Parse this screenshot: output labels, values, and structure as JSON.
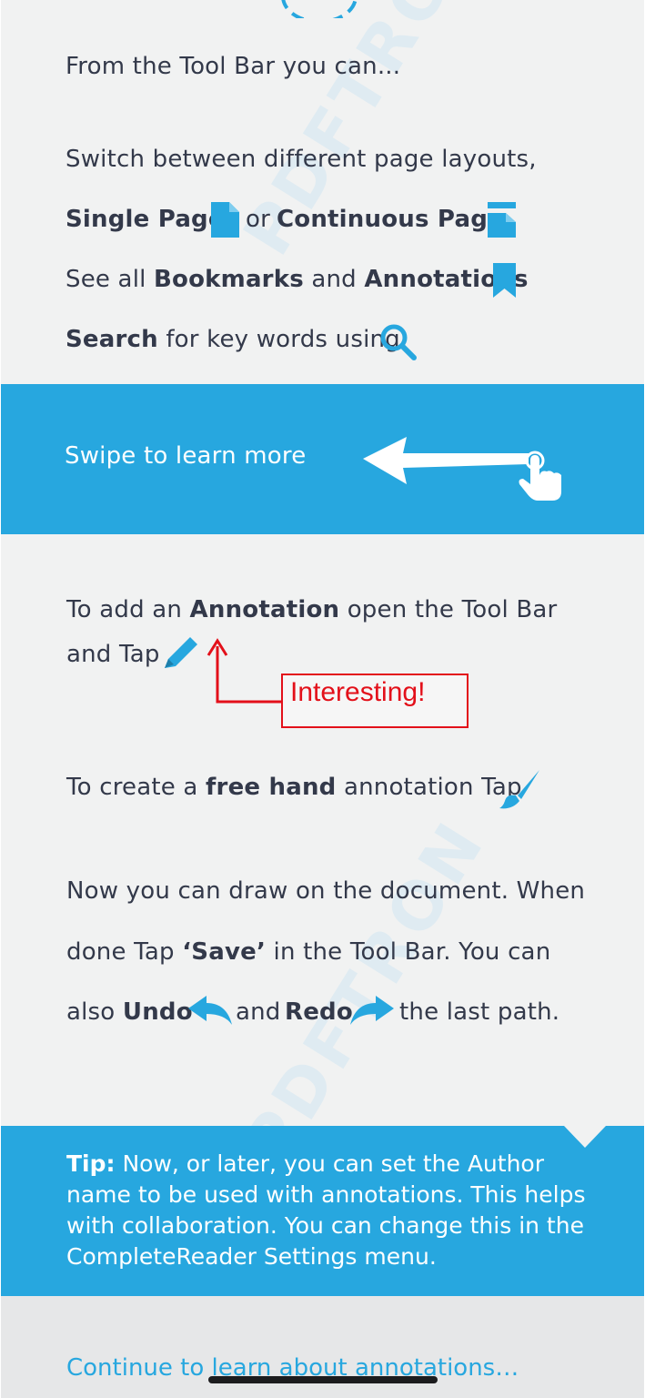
{
  "watermark": "PDFTRON",
  "toolbar_section": {
    "intro": "From the Tool Bar you can...",
    "switch_line": "Switch between different page layouts,",
    "single_page": "Single Page",
    "or": "or",
    "continuous_page": "Continuous Page",
    "see_all": "See all",
    "bookmarks": "Bookmarks",
    "and": "and",
    "annotations": "Annotations",
    "search": "Search",
    "search_rest": "for key words using"
  },
  "swipe_banner": {
    "label": "Swipe to learn more"
  },
  "annotation_section": {
    "l1_pre": "To add an",
    "l1_bold": "Annotation",
    "l1_post": "open the Tool Bar",
    "l2": "and Tap",
    "note": "Interesting!",
    "fh_pre": "To create a",
    "fh_bold": "free hand",
    "fh_post": "annotation Tap",
    "draw_l1": "Now you can draw on the document. When",
    "draw_l2_pre": "done Tap",
    "draw_l2_bold": "‘Save’",
    "draw_l2_post": "in the Tool Bar. You can",
    "draw_l3_pre": "also",
    "undo": "Undo",
    "and": "and",
    "redo": "Redo",
    "draw_l3_post": "the last path."
  },
  "tip": {
    "label": "Tip:",
    "text": "Now, or later, you can set the Author name to be used with annotations. This helps with collaboration. You can change this in the CompleteReader Settings menu."
  },
  "continue_link": "Continue to learn about annotations…",
  "colors": {
    "accent": "#27a7df",
    "background": "#f1f2f2",
    "text": "#33394a",
    "note": "#e3101a"
  }
}
